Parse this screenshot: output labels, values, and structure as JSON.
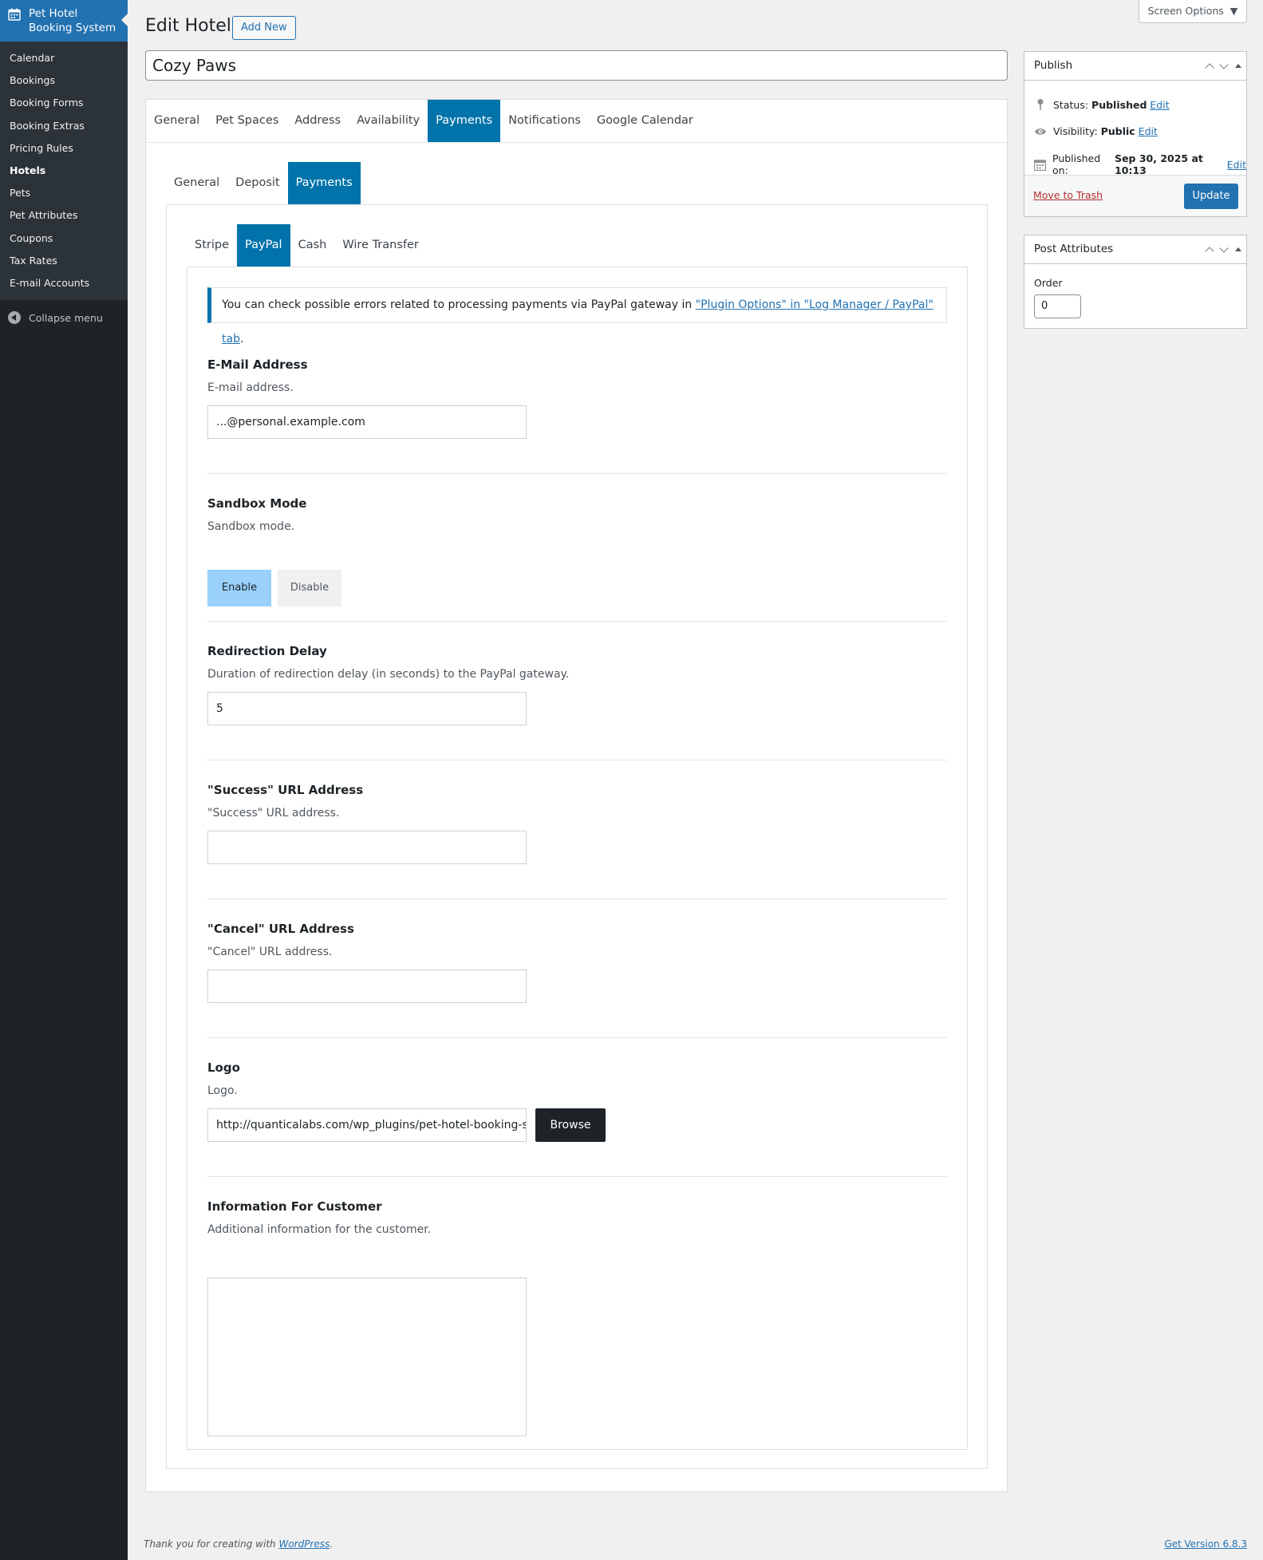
{
  "sidebar": {
    "app_title_line1": "Pet Hotel",
    "app_title_line2": "Booking System",
    "items": [
      {
        "label": "Calendar"
      },
      {
        "label": "Bookings"
      },
      {
        "label": "Booking Forms"
      },
      {
        "label": "Booking Extras"
      },
      {
        "label": "Pricing Rules"
      },
      {
        "label": "Hotels"
      },
      {
        "label": "Pets"
      },
      {
        "label": "Pet Attributes"
      },
      {
        "label": "Coupons"
      },
      {
        "label": "Tax Rates"
      },
      {
        "label": "E-mail Accounts"
      }
    ],
    "current_item": "Hotels",
    "collapse_label": "Collapse menu"
  },
  "header": {
    "title": "Edit Hotel",
    "add_new_label": "Add New",
    "screen_options_label": "Screen Options"
  },
  "post_title": "Cozy Paws",
  "tabs_level1": [
    "General",
    "Pet Spaces",
    "Address",
    "Availability",
    "Payments",
    "Notifications",
    "Google Calendar"
  ],
  "tabs_level1_active": "Payments",
  "tabs_level2": [
    "General",
    "Deposit",
    "Payments"
  ],
  "tabs_level2_active": "Payments",
  "tabs_level3": [
    "Stripe",
    "PayPal",
    "Cash",
    "Wire Transfer"
  ],
  "tabs_level3_active": "PayPal",
  "notice": {
    "text": "You can check possible errors related to processing payments via PayPal gateway in ",
    "link": "\"Plugin Options\" in \"Log Manager / PayPal\" tab",
    "suffix": "."
  },
  "fields": {
    "email": {
      "label": "E-Mail Address",
      "desc": "E-mail address.",
      "value": "...@personal.example.com"
    },
    "sandbox": {
      "label": "Sandbox Mode",
      "desc": "Sandbox mode.",
      "enable_label": "Enable",
      "disable_label": "Disable",
      "selected": "Enable"
    },
    "delay": {
      "label": "Redirection Delay",
      "desc": "Duration of redirection delay (in seconds) to the PayPal gateway.",
      "value": "5"
    },
    "success_url": {
      "label": "\"Success\" URL Address",
      "desc": "\"Success\" URL address.",
      "value": ""
    },
    "cancel_url": {
      "label": "\"Cancel\" URL Address",
      "desc": "\"Cancel\" URL address.",
      "value": ""
    },
    "logo": {
      "label": "Logo",
      "desc": "Logo.",
      "value": "http://quanticalabs.com/wp_plugins/pet-hotel-booking-s",
      "browse_label": "Browse"
    },
    "info": {
      "label": "Information For Customer",
      "desc": "Additional information for the customer.",
      "value": ""
    }
  },
  "publish_box": {
    "title": "Publish",
    "status_label": "Status:",
    "status_value": "Published",
    "visibility_label": "Visibility:",
    "visibility_value": "Public",
    "published_label": "Published on:",
    "published_value": "Sep 30, 2025 at 10:13",
    "edit_label": "Edit",
    "trash_label": "Move to Trash",
    "update_label": "Update"
  },
  "attributes_box": {
    "title": "Post Attributes",
    "order_label": "Order",
    "order_value": "0"
  },
  "footer": {
    "thanks_text": "Thank you for creating with ",
    "thanks_link": "WordPress",
    "thanks_suffix": ".",
    "version_label": "Get Version 6.8.3"
  },
  "colors": {
    "accent": "#2271b1",
    "tab_active": "#0073aa",
    "sidebar_bg": "#1d2327",
    "enable_bg": "#99d1fb",
    "trash": "#b32d2e"
  }
}
